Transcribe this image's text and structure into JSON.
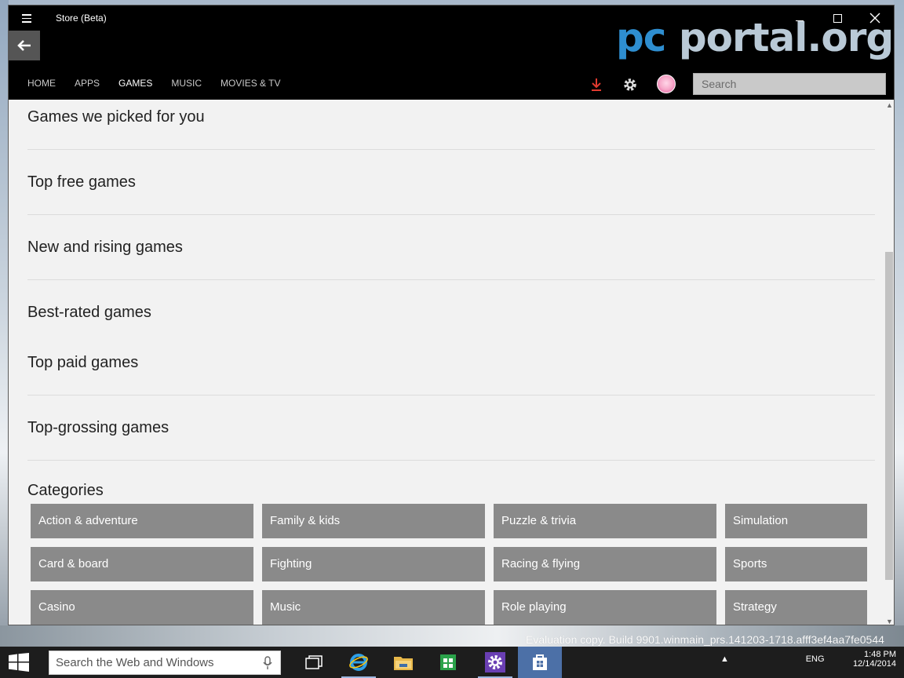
{
  "window": {
    "title": "Store (Beta)",
    "watermark_logo": "pc portal.org.ru"
  },
  "nav": {
    "items": [
      "HOME",
      "APPS",
      "GAMES",
      "MUSIC",
      "MOVIES & TV"
    ],
    "active": "GAMES"
  },
  "header": {
    "search_placeholder": "Search"
  },
  "sections": [
    "Games we picked for you",
    "Top free games",
    "New and rising games",
    "Best-rated games",
    "Top paid games",
    "Top-grossing games",
    "Categories"
  ],
  "categories": [
    "Action & adventure",
    "Family & kids",
    "Puzzle & trivia",
    "Simulation",
    "Card & board",
    "Fighting",
    "Racing & flying",
    "Sports",
    "Casino",
    "Music",
    "Role playing",
    "Strategy"
  ],
  "desktop": {
    "build_text": "Evaluation copy. Build 9901.winmain_prs.141203-1718.afff3ef4aa7fe0544"
  },
  "taskbar": {
    "search_placeholder": "Search the Web and Windows",
    "language": "ENG",
    "time": "1:48 PM",
    "date": "12/14/2014"
  },
  "colors": {
    "accent": "#2e8ed0",
    "tile": "#8a8a8a",
    "taskbar_active": "#4c70a7"
  }
}
